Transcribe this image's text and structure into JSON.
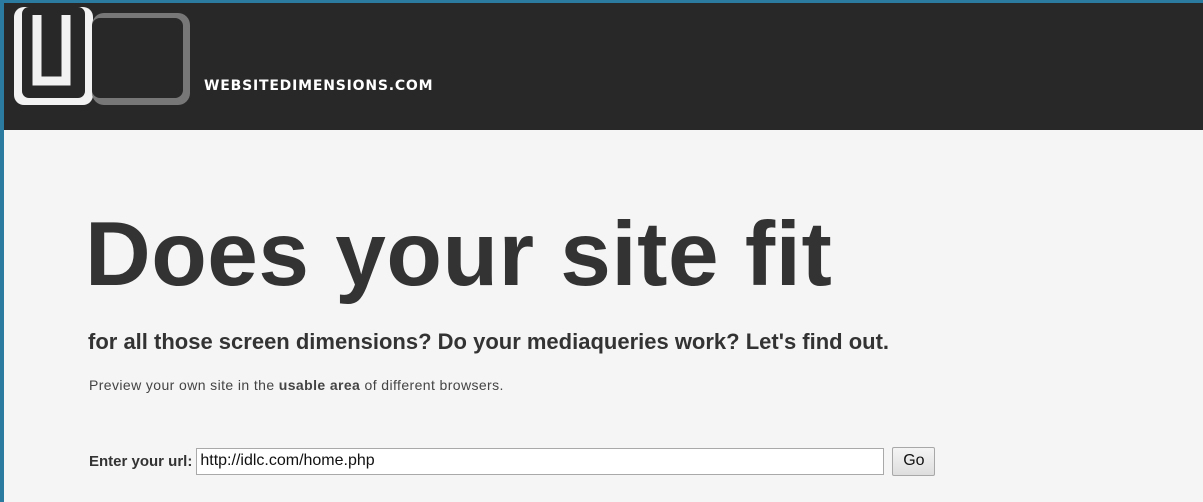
{
  "header": {
    "logo_text": "WD",
    "site_name": "WEBSITEDIMENSIONS.COM"
  },
  "hero": {
    "title": "Does your site fit",
    "subtitle": "for all those screen dimensions? Do your mediaqueries work? Let's find out.",
    "intro_before": "Preview your own site in the ",
    "intro_emphasis": "usable area",
    "intro_after": " of different browsers."
  },
  "url_form": {
    "label": "Enter your url:",
    "value": "http://idlc.com/home.php",
    "button_label": "Go"
  },
  "colors": {
    "border": "#2b7aa0",
    "header_background": "#282828",
    "page_background": "#f5f5f5",
    "logo_dark_gray": "#777777",
    "text": "#333333"
  }
}
